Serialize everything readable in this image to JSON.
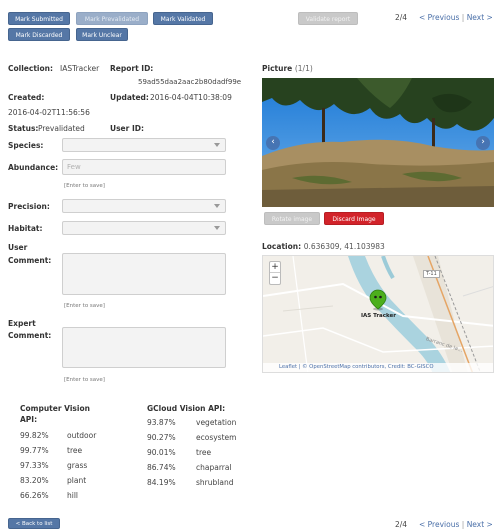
{
  "toolbar": {
    "mark_submitted": "Mark Submitted",
    "mark_prevalidated": "Mark Prevalidated",
    "mark_validated": "Mark Validated",
    "mark_discarded": "Mark Discarded",
    "mark_unclear": "Mark Unclear",
    "validate_report": "Validate report"
  },
  "pager": {
    "position": "2/4",
    "previous": "< Previous",
    "separator": "|",
    "next": "Next >"
  },
  "report": {
    "collection_label": "Collection:",
    "collection_value": "IASTracker",
    "report_id_label": "Report ID:",
    "report_id_value": "59ad55daa2aac2b80dadf99e",
    "created_label": "Created:",
    "created_value": "2016-04-02T11:56:56",
    "updated_label": "Updated:",
    "updated_value": "2016-04-04T10:38:09",
    "status_label": "Status:",
    "status_value": "Prevalidated",
    "user_id_label": "User ID:"
  },
  "form": {
    "species_label": "Species:",
    "abundance_label": "Abundance:",
    "abundance_value": "Few",
    "enter_hint": "[Enter to save]",
    "precision_label": "Precision:",
    "habitat_label": "Habitat:",
    "user_comment_label_1": "User",
    "user_comment_label_2": "Comment:",
    "expert_comment_label_1": "Expert",
    "expert_comment_label_2": "Comment:"
  },
  "picture": {
    "label": "Picture",
    "count": "(1/1)",
    "rotate_label": "Rotate image",
    "discard_label": "Discard Image"
  },
  "location": {
    "label": "Location:",
    "coords": "0.636309, 41.103983",
    "marker_label": "IAS Tracker",
    "zoom_in": "+",
    "zoom_out": "−",
    "road_label": "T-11",
    "street_label": "Barranc de la...",
    "attribution": "Leaflet | © OpenStreetMap contributors, Credit: BC-GISCO"
  },
  "vision": {
    "computer_title_1": "Computer Vision",
    "computer_title_2": "API:",
    "computer": [
      {
        "pct": "99.82%",
        "tag": "outdoor"
      },
      {
        "pct": "99.77%",
        "tag": "tree"
      },
      {
        "pct": "97.33%",
        "tag": "grass"
      },
      {
        "pct": "83.20%",
        "tag": "plant"
      },
      {
        "pct": "66.26%",
        "tag": "hill"
      }
    ],
    "gcloud_title": "GCloud Vision API:",
    "gcloud": [
      {
        "pct": "93.87%",
        "tag": "vegetation"
      },
      {
        "pct": "90.27%",
        "tag": "ecosystem"
      },
      {
        "pct": "90.01%",
        "tag": "tree"
      },
      {
        "pct": "86.74%",
        "tag": "chaparral"
      },
      {
        "pct": "84.19%",
        "tag": "shrubland"
      }
    ]
  },
  "footer": {
    "back_label": "< Back to list"
  },
  "colors": {
    "primary": "#5577a6",
    "danger": "#d2232a",
    "link": "#4a6fa8",
    "water": "#aad3df"
  }
}
